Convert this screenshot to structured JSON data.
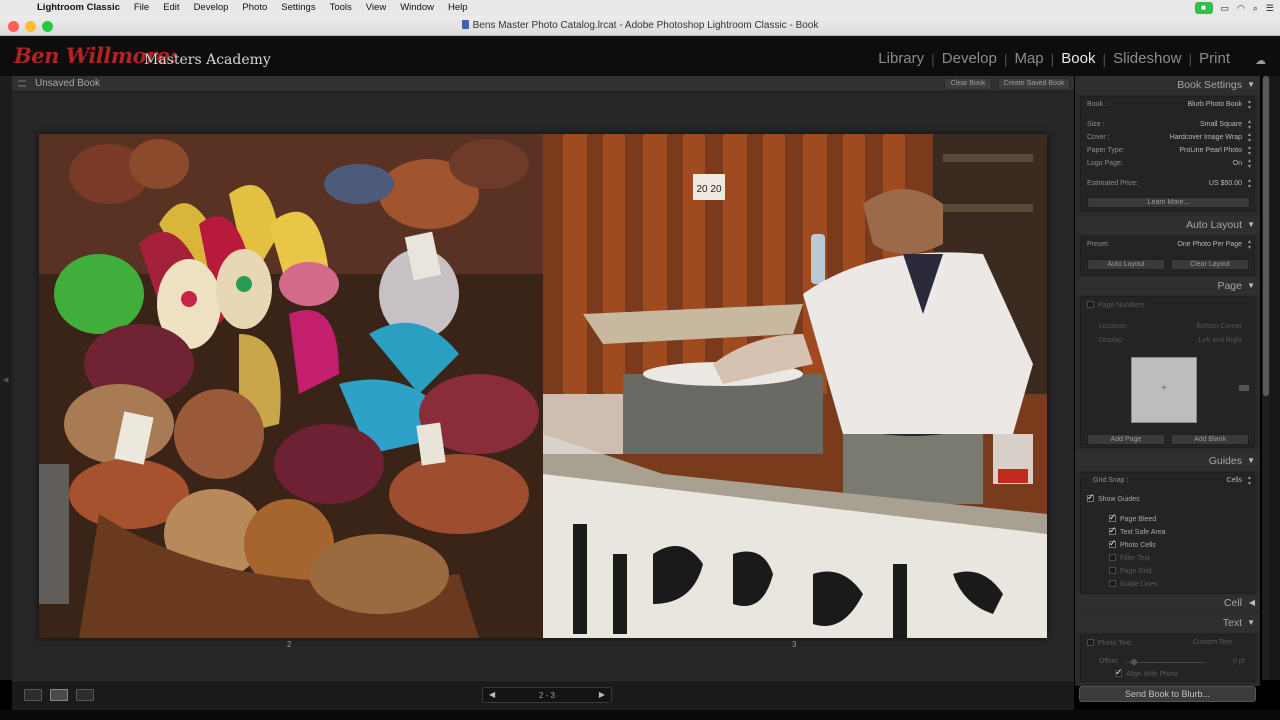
{
  "menubar": {
    "app_name": "Lightroom Classic",
    "items": [
      "File",
      "Edit",
      "Develop",
      "Photo",
      "Settings",
      "Tools",
      "View",
      "Window",
      "Help"
    ]
  },
  "window": {
    "title": "Bens Master Photo Catalog.lrcat - Adobe Photoshop Lightroom Classic - Book"
  },
  "identity": {
    "script": "Ben Willmore:",
    "text": "Masters Academy"
  },
  "modules": [
    "Library",
    "Develop",
    "Map",
    "Book",
    "Slideshow",
    "Print"
  ],
  "active_module": "Book",
  "book_header": {
    "title": "Unsaved Book",
    "clear_book": "Clear Book",
    "create_saved_book": "Create Saved Book"
  },
  "spread": {
    "left_page_number": "2",
    "right_page_number": "3",
    "right_photo_sign": "20 20"
  },
  "toolbar": {
    "page_range": "2 - 3"
  },
  "book_settings": {
    "header": "Book Settings",
    "book_label": "Book :",
    "book_value": "Blurb Photo Book",
    "size_label": "Size :",
    "size_value": "Small Square",
    "cover_label": "Cover :",
    "cover_value": "Hardcover Image Wrap",
    "paper_label": "Paper Type:",
    "paper_value": "ProLine Pearl Photo",
    "logo_label": "Logo Page:",
    "logo_value": "On",
    "price_label": "Estimated Price:",
    "price_value": "US $50.00",
    "learn_more": "Learn More..."
  },
  "auto_layout": {
    "header": "Auto Layout",
    "preset_label": "Preset:",
    "preset_value": "One Photo Per Page",
    "auto_layout_btn": "Auto Layout",
    "clear_layout_btn": "Clear Layout"
  },
  "page_panel": {
    "header": "Page",
    "page_numbers": "Page Numbers",
    "location_label": "Location:",
    "location_value": "Bottom Corner",
    "display_label": "Display:",
    "display_value": "Left and Right",
    "add_page": "Add Page",
    "add_blank": "Add Blank"
  },
  "guides": {
    "header": "Guides",
    "grid_snap_label": "Grid Snap :",
    "grid_snap_value": "Cells",
    "show_guides": "Show Guides",
    "page_bleed": "Page Bleed",
    "text_safe_area": "Text Safe Area",
    "photo_cells": "Photo Cells",
    "filler_text": "Filler Text",
    "page_grid": "Page Grid",
    "guide_lines": "Guide Lines"
  },
  "cell_panel": {
    "header": "Cell"
  },
  "text_panel": {
    "header": "Text",
    "photo_text": "Photo Text",
    "photo_text_value": "Custom Text",
    "offset_label": "Offset",
    "offset_value": "0 pt",
    "align_with_photo": "Align With Photo"
  },
  "send_button": "Send Book to Blurb..."
}
